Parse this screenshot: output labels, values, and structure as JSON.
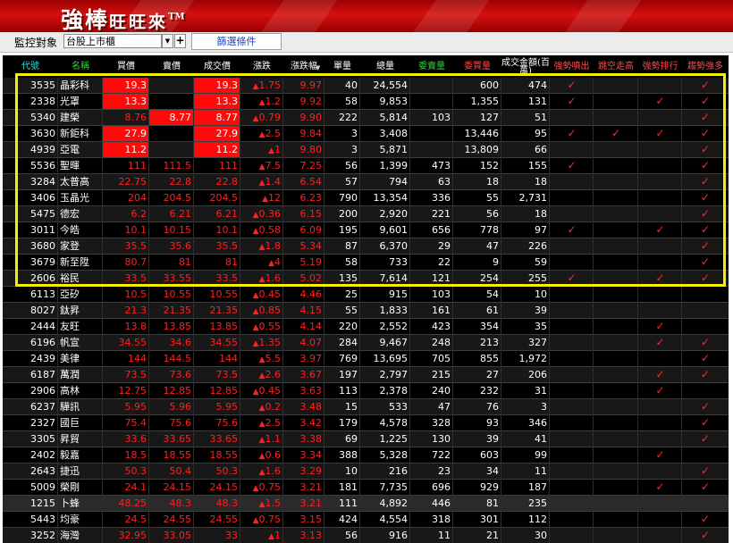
{
  "banner": {
    "title": "強棒",
    "subtitle": "旺旺來",
    "trademark": "TM"
  },
  "toolbar": {
    "monitor_label": "監控對象",
    "target_value": "台股上市櫃",
    "dropdown_arrow": "▼",
    "plus_label": "+",
    "filter_button": "篩選條件"
  },
  "colors": {
    "header_cyan": "#29e3e3",
    "header_green": "#35d43a",
    "header_white": "#ffffff",
    "header_red": "#ff4a4a",
    "up_red": "#ff2020",
    "limit_bg": "#ff0a0a",
    "highlight": "#f5ee00"
  },
  "columns": [
    {
      "key": "code",
      "label": "代號"
    },
    {
      "key": "name",
      "label": "名稱"
    },
    {
      "key": "bid",
      "label": "買價"
    },
    {
      "key": "ask",
      "label": "賣價"
    },
    {
      "key": "last",
      "label": "成交價"
    },
    {
      "key": "change",
      "label": "漲跌"
    },
    {
      "key": "pct",
      "label": "漲跌幅"
    },
    {
      "key": "vol",
      "label": "單量"
    },
    {
      "key": "total",
      "label": "總量"
    },
    {
      "key": "ask_qty",
      "label": "委賣量"
    },
    {
      "key": "bid_qty",
      "label": "委買量"
    },
    {
      "key": "amount",
      "label": "成交金額(百萬)"
    },
    {
      "key": "f1",
      "label": "強勢噴出"
    },
    {
      "key": "f2",
      "label": "跳空走高"
    },
    {
      "key": "f3",
      "label": "強勢排行"
    },
    {
      "key": "f4",
      "label": "趨勢強多"
    }
  ],
  "sort_indicator": "▼",
  "up_symbol": "▲",
  "check_symbol": "✓",
  "rows": [
    {
      "code": "3535",
      "name": "晶彩科",
      "bid": "19.3",
      "ask": "",
      "last": "19.3",
      "change": "1.75",
      "pct": "9.97",
      "vol": "40",
      "total": "24,554",
      "ask_qty": "",
      "bid_qty": "600",
      "amount": "474",
      "limit_bid": true,
      "limit_ask": false,
      "limit_last": true,
      "f": [
        true,
        false,
        false,
        true
      ]
    },
    {
      "code": "2338",
      "name": "光罩",
      "bid": "13.3",
      "ask": "",
      "last": "13.3",
      "change": "1.2",
      "pct": "9.92",
      "vol": "58",
      "total": "9,853",
      "ask_qty": "",
      "bid_qty": "1,355",
      "amount": "131",
      "limit_bid": true,
      "limit_ask": false,
      "limit_last": true,
      "f": [
        true,
        false,
        true,
        true
      ]
    },
    {
      "code": "5340",
      "name": "建榮",
      "bid": "8.76",
      "ask": "8.77",
      "last": "8.77",
      "change": "0.79",
      "pct": "9.90",
      "vol": "222",
      "total": "5,814",
      "ask_qty": "103",
      "bid_qty": "127",
      "amount": "51",
      "limit_bid": false,
      "limit_ask": true,
      "limit_last": true,
      "f": [
        false,
        false,
        false,
        true
      ]
    },
    {
      "code": "3630",
      "name": "新鉅科",
      "bid": "27.9",
      "ask": "",
      "last": "27.9",
      "change": "2.5",
      "pct": "9.84",
      "vol": "3",
      "total": "3,408",
      "ask_qty": "",
      "bid_qty": "13,446",
      "amount": "95",
      "limit_bid": true,
      "limit_ask": false,
      "limit_last": true,
      "f": [
        true,
        true,
        true,
        true
      ]
    },
    {
      "code": "4939",
      "name": "亞電",
      "bid": "11.2",
      "ask": "",
      "last": "11.2",
      "change": "1",
      "pct": "9.80",
      "vol": "3",
      "total": "5,871",
      "ask_qty": "",
      "bid_qty": "13,809",
      "amount": "66",
      "limit_bid": true,
      "limit_ask": false,
      "limit_last": true,
      "f": [
        false,
        false,
        false,
        true
      ]
    },
    {
      "code": "5536",
      "name": "聖暉",
      "bid": "111",
      "ask": "111.5",
      "last": "111",
      "change": "7.5",
      "pct": "7.25",
      "vol": "56",
      "total": "1,399",
      "ask_qty": "473",
      "bid_qty": "152",
      "amount": "155",
      "limit_bid": false,
      "limit_ask": false,
      "limit_last": false,
      "f": [
        true,
        false,
        false,
        true
      ]
    },
    {
      "code": "3284",
      "name": "太普高",
      "bid": "22.75",
      "ask": "22.8",
      "last": "22.8",
      "change": "1.4",
      "pct": "6.54",
      "vol": "57",
      "total": "794",
      "ask_qty": "63",
      "bid_qty": "18",
      "amount": "18",
      "limit_bid": false,
      "limit_ask": false,
      "limit_last": false,
      "f": [
        false,
        false,
        false,
        true
      ]
    },
    {
      "code": "3406",
      "name": "玉晶光",
      "bid": "204",
      "ask": "204.5",
      "last": "204.5",
      "change": "12",
      "pct": "6.23",
      "vol": "790",
      "total": "13,354",
      "ask_qty": "336",
      "bid_qty": "55",
      "amount": "2,731",
      "limit_bid": false,
      "limit_ask": false,
      "limit_last": false,
      "f": [
        false,
        false,
        false,
        true
      ]
    },
    {
      "code": "5475",
      "name": "德宏",
      "bid": "6.2",
      "ask": "6.21",
      "last": "6.21",
      "change": "0.36",
      "pct": "6.15",
      "vol": "200",
      "total": "2,920",
      "ask_qty": "221",
      "bid_qty": "56",
      "amount": "18",
      "limit_bid": false,
      "limit_ask": false,
      "limit_last": false,
      "f": [
        false,
        false,
        false,
        true
      ]
    },
    {
      "code": "3011",
      "name": "今皓",
      "bid": "10.1",
      "ask": "10.15",
      "last": "10.1",
      "change": "0.58",
      "pct": "6.09",
      "vol": "195",
      "total": "9,601",
      "ask_qty": "656",
      "bid_qty": "778",
      "amount": "97",
      "limit_bid": false,
      "limit_ask": false,
      "limit_last": false,
      "f": [
        true,
        false,
        true,
        true
      ]
    },
    {
      "code": "3680",
      "name": "家登",
      "bid": "35.5",
      "ask": "35.6",
      "last": "35.5",
      "change": "1.8",
      "pct": "5.34",
      "vol": "87",
      "total": "6,370",
      "ask_qty": "29",
      "bid_qty": "47",
      "amount": "226",
      "limit_bid": false,
      "limit_ask": false,
      "limit_last": false,
      "f": [
        false,
        false,
        false,
        true
      ]
    },
    {
      "code": "3679",
      "name": "新至陞",
      "bid": "80.7",
      "ask": "81",
      "last": "81",
      "change": "4",
      "pct": "5.19",
      "vol": "58",
      "total": "733",
      "ask_qty": "22",
      "bid_qty": "9",
      "amount": "59",
      "limit_bid": false,
      "limit_ask": false,
      "limit_last": false,
      "f": [
        false,
        false,
        false,
        true
      ]
    },
    {
      "code": "2606",
      "name": "裕民",
      "bid": "33.5",
      "ask": "33.55",
      "last": "33.5",
      "change": "1.6",
      "pct": "5.02",
      "vol": "135",
      "total": "7,614",
      "ask_qty": "121",
      "bid_qty": "254",
      "amount": "255",
      "limit_bid": false,
      "limit_ask": false,
      "limit_last": false,
      "f": [
        true,
        false,
        true,
        true
      ]
    },
    {
      "code": "6113",
      "name": "亞矽",
      "bid": "10.5",
      "ask": "10.55",
      "last": "10.55",
      "change": "0.45",
      "pct": "4.46",
      "vol": "25",
      "total": "915",
      "ask_qty": "103",
      "bid_qty": "54",
      "amount": "10",
      "limit_bid": false,
      "limit_ask": false,
      "limit_last": false,
      "f": [
        false,
        false,
        false,
        false
      ]
    },
    {
      "code": "8027",
      "name": "鈦昇",
      "bid": "21.3",
      "ask": "21.35",
      "last": "21.35",
      "change": "0.85",
      "pct": "4.15",
      "vol": "55",
      "total": "1,833",
      "ask_qty": "161",
      "bid_qty": "61",
      "amount": "39",
      "limit_bid": false,
      "limit_ask": false,
      "limit_last": false,
      "f": [
        false,
        false,
        false,
        false
      ]
    },
    {
      "code": "2444",
      "name": "友旺",
      "bid": "13.8",
      "ask": "13.85",
      "last": "13.85",
      "change": "0.55",
      "pct": "4.14",
      "vol": "220",
      "total": "2,552",
      "ask_qty": "423",
      "bid_qty": "354",
      "amount": "35",
      "limit_bid": false,
      "limit_ask": false,
      "limit_last": false,
      "f": [
        false,
        false,
        true,
        false
      ]
    },
    {
      "code": "6196",
      "name": "帆宣",
      "bid": "34.55",
      "ask": "34.6",
      "last": "34.55",
      "change": "1.35",
      "pct": "4.07",
      "vol": "284",
      "total": "9,467",
      "ask_qty": "248",
      "bid_qty": "213",
      "amount": "327",
      "limit_bid": false,
      "limit_ask": false,
      "limit_last": false,
      "f": [
        false,
        false,
        true,
        true
      ]
    },
    {
      "code": "2439",
      "name": "美律",
      "bid": "144",
      "ask": "144.5",
      "last": "144",
      "change": "5.5",
      "pct": "3.97",
      "vol": "769",
      "total": "13,695",
      "ask_qty": "705",
      "bid_qty": "855",
      "amount": "1,972",
      "limit_bid": false,
      "limit_ask": false,
      "limit_last": false,
      "f": [
        false,
        false,
        false,
        true
      ]
    },
    {
      "code": "6187",
      "name": "萬潤",
      "bid": "73.5",
      "ask": "73.6",
      "last": "73.5",
      "change": "2.6",
      "pct": "3.67",
      "vol": "197",
      "total": "2,797",
      "ask_qty": "215",
      "bid_qty": "27",
      "amount": "206",
      "limit_bid": false,
      "limit_ask": false,
      "limit_last": false,
      "f": [
        false,
        false,
        true,
        true
      ]
    },
    {
      "code": "2906",
      "name": "高林",
      "bid": "12.75",
      "ask": "12.85",
      "last": "12.85",
      "change": "0.45",
      "pct": "3.63",
      "vol": "113",
      "total": "2,378",
      "ask_qty": "240",
      "bid_qty": "232",
      "amount": "31",
      "limit_bid": false,
      "limit_ask": false,
      "limit_last": false,
      "f": [
        false,
        false,
        true,
        false
      ]
    },
    {
      "code": "6237",
      "name": "驊訊",
      "bid": "5.95",
      "ask": "5.96",
      "last": "5.95",
      "change": "0.2",
      "pct": "3.48",
      "vol": "15",
      "total": "533",
      "ask_qty": "47",
      "bid_qty": "76",
      "amount": "3",
      "limit_bid": false,
      "limit_ask": false,
      "limit_last": false,
      "f": [
        false,
        false,
        false,
        true
      ]
    },
    {
      "code": "2327",
      "name": "國巨",
      "bid": "75.4",
      "ask": "75.6",
      "last": "75.6",
      "change": "2.5",
      "pct": "3.42",
      "vol": "179",
      "total": "4,578",
      "ask_qty": "328",
      "bid_qty": "93",
      "amount": "346",
      "limit_bid": false,
      "limit_ask": false,
      "limit_last": false,
      "f": [
        false,
        false,
        false,
        true
      ]
    },
    {
      "code": "3305",
      "name": "昇貿",
      "bid": "33.6",
      "ask": "33.65",
      "last": "33.65",
      "change": "1.1",
      "pct": "3.38",
      "vol": "69",
      "total": "1,225",
      "ask_qty": "130",
      "bid_qty": "39",
      "amount": "41",
      "limit_bid": false,
      "limit_ask": false,
      "limit_last": false,
      "f": [
        false,
        false,
        false,
        true
      ]
    },
    {
      "code": "2402",
      "name": "毅嘉",
      "bid": "18.5",
      "ask": "18.55",
      "last": "18.55",
      "change": "0.6",
      "pct": "3.34",
      "vol": "388",
      "total": "5,328",
      "ask_qty": "722",
      "bid_qty": "603",
      "amount": "99",
      "limit_bid": false,
      "limit_ask": false,
      "limit_last": false,
      "f": [
        false,
        false,
        true,
        false
      ]
    },
    {
      "code": "2643",
      "name": "捷迅",
      "bid": "50.3",
      "ask": "50.4",
      "last": "50.3",
      "change": "1.6",
      "pct": "3.29",
      "vol": "10",
      "total": "216",
      "ask_qty": "23",
      "bid_qty": "34",
      "amount": "11",
      "limit_bid": false,
      "limit_ask": false,
      "limit_last": false,
      "f": [
        false,
        false,
        false,
        true
      ]
    },
    {
      "code": "5009",
      "name": "榮剛",
      "bid": "24.1",
      "ask": "24.15",
      "last": "24.15",
      "change": "0.75",
      "pct": "3.21",
      "vol": "181",
      "total": "7,735",
      "ask_qty": "696",
      "bid_qty": "929",
      "amount": "187",
      "limit_bid": false,
      "limit_ask": false,
      "limit_last": false,
      "f": [
        false,
        false,
        true,
        true
      ]
    },
    {
      "code": "1215",
      "name": "卜蜂",
      "bid": "48.25",
      "ask": "48.3",
      "last": "48.3",
      "change": "1.5",
      "pct": "3.21",
      "vol": "111",
      "total": "4,892",
      "ask_qty": "446",
      "bid_qty": "81",
      "amount": "235",
      "limit_bid": false,
      "limit_ask": false,
      "limit_last": false,
      "f": [
        false,
        false,
        false,
        false
      ]
    },
    {
      "code": "5443",
      "name": "均豪",
      "bid": "24.5",
      "ask": "24.55",
      "last": "24.55",
      "change": "0.75",
      "pct": "3.15",
      "vol": "424",
      "total": "4,554",
      "ask_qty": "318",
      "bid_qty": "301",
      "amount": "112",
      "limit_bid": false,
      "limit_ask": false,
      "limit_last": false,
      "f": [
        false,
        false,
        false,
        true
      ]
    },
    {
      "code": "3252",
      "name": "海灣",
      "bid": "32.95",
      "ask": "33.05",
      "last": "33",
      "change": "1",
      "pct": "3.13",
      "vol": "56",
      "total": "916",
      "ask_qty": "11",
      "bid_qty": "21",
      "amount": "30",
      "limit_bid": false,
      "limit_ask": false,
      "limit_last": false,
      "f": [
        false,
        false,
        false,
        true
      ]
    }
  ]
}
